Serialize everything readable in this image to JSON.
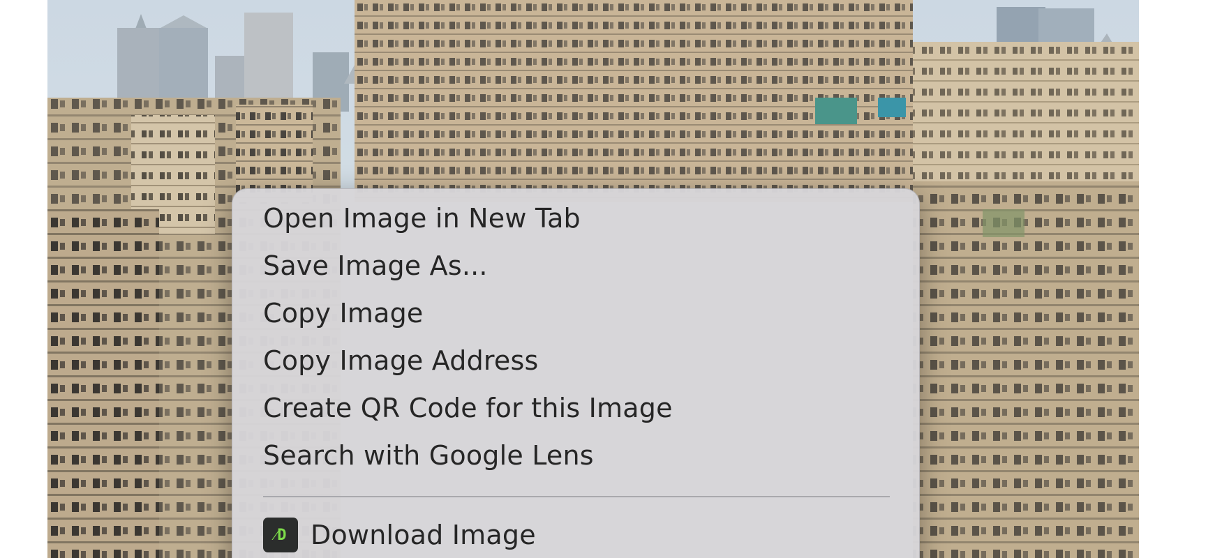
{
  "context_menu": {
    "items": [
      {
        "label": "Open Image in New Tab"
      },
      {
        "label": "Save Image As..."
      },
      {
        "label": "Copy Image"
      },
      {
        "label": "Copy Image Address"
      },
      {
        "label": "Create QR Code for this Image"
      },
      {
        "label": "Search with Google Lens"
      }
    ],
    "extension_item": {
      "label": "Download Image",
      "icon": "download-extension-icon",
      "icon_text": "⁄D",
      "icon_color": "#7ddc4a"
    }
  }
}
